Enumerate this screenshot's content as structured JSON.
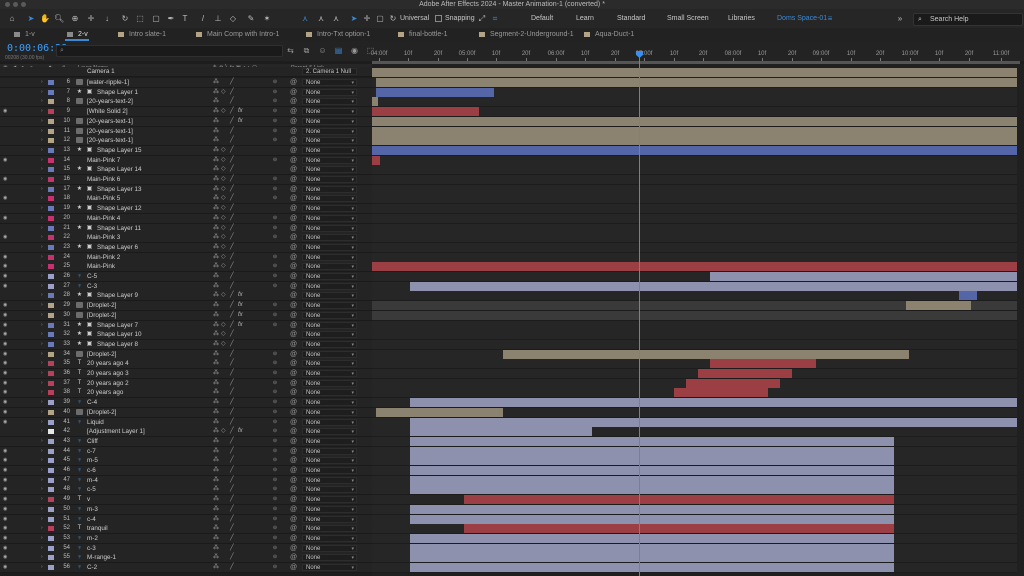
{
  "app_title": "Adobe After Effects 2024 - Master Animation-1 (converted) *",
  "toolbar": {
    "universal_label": "Universal",
    "snapping_label": "Snapping",
    "workspaces": [
      "Default",
      "Learn",
      "Standard",
      "Small Screen",
      "Libraries",
      "Doms Space-01"
    ],
    "active_workspace": "Doms Space-01",
    "search_placeholder": "Search Help"
  },
  "tabs": [
    {
      "label": "1-v",
      "color": "#8a8a8a"
    },
    {
      "label": "2-v",
      "color": "#8a8a8a",
      "active": true
    },
    {
      "label": "Intro slate-1",
      "color": "#b3a486"
    },
    {
      "label": "Main Comp with Intro-1",
      "color": "#b3a486"
    },
    {
      "label": "Intro-Txt option-1",
      "color": "#b3a486"
    },
    {
      "label": "final-bottle-1",
      "color": "#b3a486"
    },
    {
      "label": "Segment-2-Underground-1",
      "color": "#b3a486"
    },
    {
      "label": "Aqua-Duct-1",
      "color": "#b3a486"
    }
  ],
  "timecode": "0:00:06:28",
  "fps_label": "00208 (30.00 fps)",
  "layer_search_placeholder": "",
  "columns": {
    "layer_name": "Layer Name",
    "parent_link": "Parent & Link"
  },
  "ruler_ticks": [
    "04:00f",
    "10f",
    "20f",
    "05:00f",
    "10f",
    "20f",
    "06:00f",
    "10f",
    "20f",
    "07:00f",
    "10f",
    "20f",
    "08:00f",
    "10f",
    "20f",
    "09:00f",
    "10f",
    "20f",
    "10:00f",
    "10f",
    "20f",
    "11:00f"
  ],
  "parent_default": "None",
  "top_row_name": "Camera 1",
  "top_row_parent": "2. Camera 1 Null",
  "layers": [
    {
      "n": "6",
      "name": "[water-ripple-1]",
      "type": "src",
      "color": "#6a79b8",
      "eye": false
    },
    {
      "n": "7",
      "name": "Shape Layer 1",
      "type": "star",
      "color": "#6a79b8",
      "eye": false
    },
    {
      "n": "8",
      "name": "[20-years-text-2]",
      "type": "src",
      "color": "#b3a486",
      "eye": false
    },
    {
      "n": "9",
      "name": "[White Solid 2]",
      "type": "solid",
      "color": "#b8405a",
      "eye": true
    },
    {
      "n": "10",
      "name": "[20-years-text-1]",
      "type": "src",
      "color": "#b3a486",
      "eye": false
    },
    {
      "n": "11",
      "name": "[20-years-text-1]",
      "type": "src",
      "color": "#b3a486",
      "eye": false
    },
    {
      "n": "12",
      "name": "[20-years-text-1]",
      "type": "src",
      "color": "#b3a486",
      "eye": false
    },
    {
      "n": "13",
      "name": "Shape Layer 15",
      "type": "star",
      "color": "#6a79b8",
      "eye": false
    },
    {
      "n": "14",
      "name": "Main-Pink 7",
      "type": "solid",
      "color": "#c4336d",
      "eye": true
    },
    {
      "n": "15",
      "name": "Shape Layer 14",
      "type": "star",
      "color": "#6a79b8",
      "eye": false
    },
    {
      "n": "16",
      "name": "Main-Pink 6",
      "type": "solid",
      "color": "#c4336d",
      "eye": true
    },
    {
      "n": "17",
      "name": "Shape Layer 13",
      "type": "star",
      "color": "#6a79b8",
      "eye": false
    },
    {
      "n": "18",
      "name": "Main-Pink 5",
      "type": "solid",
      "color": "#c4336d",
      "eye": true
    },
    {
      "n": "19",
      "name": "Shape Layer 12",
      "type": "star",
      "color": "#6a79b8",
      "eye": false
    },
    {
      "n": "20",
      "name": "Main-Pink 4",
      "type": "solid",
      "color": "#c4336d",
      "eye": true
    },
    {
      "n": "21",
      "name": "Shape Layer 11",
      "type": "star",
      "color": "#6a79b8",
      "eye": false
    },
    {
      "n": "22",
      "name": "Main-Pink 3",
      "type": "solid",
      "color": "#c4336d",
      "eye": true
    },
    {
      "n": "23",
      "name": "Shape Layer 6",
      "type": "star",
      "color": "#6a79b8",
      "eye": false
    },
    {
      "n": "24",
      "name": "Main-Pink 2",
      "type": "solid",
      "color": "#c4336d",
      "eye": true
    },
    {
      "n": "25",
      "name": "Main-Pink",
      "type": "solid",
      "color": "#c4336d",
      "eye": true
    },
    {
      "n": "26",
      "name": "C-5",
      "type": "av",
      "color": "#9aa0c8",
      "eye": true
    },
    {
      "n": "27",
      "name": "C-3",
      "type": "av",
      "color": "#9aa0c8",
      "eye": true
    },
    {
      "n": "28",
      "name": "Shape Layer 9",
      "type": "star",
      "color": "#6a79b8",
      "eye": false
    },
    {
      "n": "29",
      "name": "[Droplet-2]",
      "type": "src",
      "color": "#b3a486",
      "eye": true
    },
    {
      "n": "30",
      "name": "[Droplet-2]",
      "type": "src",
      "color": "#b3a486",
      "eye": true
    },
    {
      "n": "31",
      "name": "Shape Layer 7",
      "type": "star",
      "color": "#6a79b8",
      "eye": true
    },
    {
      "n": "32",
      "name": "Shape Layer 10",
      "type": "star",
      "color": "#6a79b8",
      "eye": true
    },
    {
      "n": "33",
      "name": "Shape Layer 8",
      "type": "star",
      "color": "#6a79b8",
      "eye": true
    },
    {
      "n": "34",
      "name": "[Droplet-2]",
      "type": "src",
      "color": "#b3a486",
      "eye": true
    },
    {
      "n": "35",
      "name": "20 years ago 4",
      "type": "text",
      "color": "#b8405a",
      "eye": true
    },
    {
      "n": "36",
      "name": "20 years ago 3",
      "type": "text",
      "color": "#b8405a",
      "eye": true
    },
    {
      "n": "37",
      "name": "20 years ago 2",
      "type": "text",
      "color": "#b8405a",
      "eye": true
    },
    {
      "n": "38",
      "name": "20 years ago",
      "type": "text",
      "color": "#b8405a",
      "eye": true
    },
    {
      "n": "39",
      "name": "C-4",
      "type": "av",
      "color": "#9aa0c8",
      "eye": true
    },
    {
      "n": "40",
      "name": "[Droplet-2]",
      "type": "src",
      "color": "#b3a486",
      "eye": true
    },
    {
      "n": "41",
      "name": "Liquid",
      "type": "av",
      "color": "#9aa0c8",
      "eye": true
    },
    {
      "n": "42",
      "name": "[Adjustment Layer 1]",
      "type": "solid",
      "color": "#e6e6e6",
      "eye": false
    },
    {
      "n": "43",
      "name": "Cliff",
      "type": "av",
      "color": "#9aa0c8",
      "eye": false
    },
    {
      "n": "44",
      "name": "c-7",
      "type": "av",
      "color": "#9aa0c8",
      "eye": true
    },
    {
      "n": "45",
      "name": "m-5",
      "type": "av",
      "color": "#9aa0c8",
      "eye": true
    },
    {
      "n": "46",
      "name": "c-6",
      "type": "av",
      "color": "#9aa0c8",
      "eye": true
    },
    {
      "n": "47",
      "name": "m-4",
      "type": "av",
      "color": "#9aa0c8",
      "eye": true
    },
    {
      "n": "48",
      "name": "c-5",
      "type": "av",
      "color": "#9aa0c8",
      "eye": true
    },
    {
      "n": "49",
      "name": "v",
      "type": "text",
      "color": "#b8405a",
      "eye": true
    },
    {
      "n": "50",
      "name": "m-3",
      "type": "av",
      "color": "#9aa0c8",
      "eye": true
    },
    {
      "n": "51",
      "name": "c-4",
      "type": "av",
      "color": "#9aa0c8",
      "eye": true
    },
    {
      "n": "52",
      "name": "tranquil",
      "type": "text",
      "color": "#b8405a",
      "eye": true
    },
    {
      "n": "53",
      "name": "m-2",
      "type": "av",
      "color": "#9aa0c8",
      "eye": true
    },
    {
      "n": "54",
      "name": "c-3",
      "type": "av",
      "color": "#9aa0c8",
      "eye": true
    },
    {
      "n": "55",
      "name": "M-range-1",
      "type": "av",
      "color": "#9aa0c8",
      "eye": true
    },
    {
      "n": "56",
      "name": "C-2",
      "type": "av",
      "color": "#9aa0c8",
      "eye": true
    }
  ],
  "bar_colors": {
    "tan": "#8c8270",
    "blue": "#5566a8",
    "red": "#9b3f44",
    "lav": "#8e91ad",
    "dim": "#3a3a3a"
  }
}
